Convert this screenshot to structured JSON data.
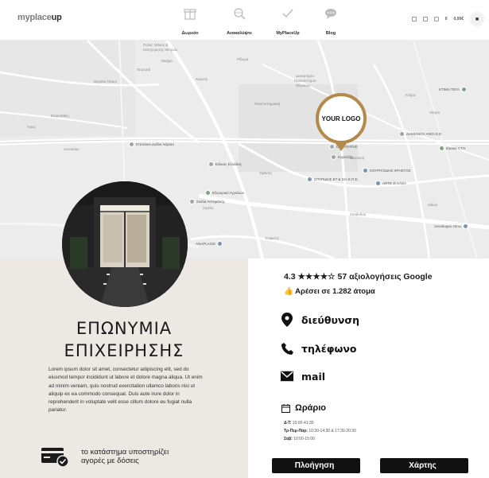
{
  "header": {
    "logo_main": "myplace",
    "logo_accent": "up",
    "nav": [
      {
        "label": "Δωρεάν",
        "icon": "gift-icon"
      },
      {
        "label": "Ανακαλύψτε",
        "icon": "search-globe-icon"
      },
      {
        "label": "MyPlaceUp",
        "icon": "checkmark-icon"
      },
      {
        "label": "Blog",
        "icon": "chat-bubble-icon"
      }
    ],
    "cart_amount": "0,00€",
    "cart_count": "0"
  },
  "map": {
    "pin_label": "YOUR LOGO",
    "labels": [
      "Πολύς Μάκας &",
      "Κατηγορητής Μετρών",
      "Μνήμα",
      "Πετρωτά",
      "Χαρνόλ",
      "Μεγάλο Πεύκο",
      "Ρίζωμα",
      "Διοικητήριο",
      "Πανεπιστήμιο",
      "Πειραιώς",
      "Πανεπιστημιακή",
      "Άγιος",
      "Ευρωπαϊκή",
      "Σιγάλα",
      "Κτήμα",
      "Αθηνά",
      "Καρπερή",
      "Ιαθών",
      "Λενουαίοι",
      "Σαλβαδόρ",
      "Κηφισός",
      "Υφάντες"
    ],
    "pois": [
      "Επιτελικό Διόδιο Λάρισα",
      "Ειδικός Ελλάδας",
      "Εξωτερικό Αγγελιών",
      "Σκάλα Αστυφάνης",
      "ΣΠΥΡΙΔΗΣ ΕΤ & ΣΙΑ Ε.Π.Ε.",
      "ΚΟΥΡΙΤΖΙΔΗΣ ΧΡΗΣΤΟΣ",
      "ARTE di CASA",
      "Καρατζής",
      "ANAPLASIS",
      "ΔΑΜΙΑΝΟΥ ΑΦΟΙ Ε.Ε.",
      "Ελαϊκα CTH",
      "Ξενοδοχείο Olmo",
      "KTIMA TEFA",
      "Ο ΜΑΧΗΤΗΣ"
    ]
  },
  "business": {
    "name_line1": "ΕΠΩΝΥΜΙΑ",
    "name_line2": "ΕΠΙΧΕΙΡΗΣΗΣ",
    "description": "Lorem ipsum dolor sit amet, consectetur adipiscing elit, sed do eiusmod tempor incididunt ut labore et dolore magna aliqua. Ut enim ad minim veniam, quis nostrud exercitation ullamco laboris nisi ut aliquip ex ea commodo consequat. Duis aute irure dolor in reprehenderit in voluptate velit esse cillum dolore eu fugiat nulla pariatur.",
    "installments_line1": "το κατάστημα υποστηρίζει",
    "installments_line2": "αγορές με δόσεις"
  },
  "info": {
    "rating_text": "4.3 ★★★★☆ 57 αξιολογήσεις Google",
    "likes_text": "Αρέσει σε 1.282 άτομα",
    "address_label": "διεύθυνση",
    "phone_label": "τηλέφωνο",
    "mail_label": "mail",
    "hours_title": "Ωράριο",
    "hours": [
      {
        "days": "Δ-Τ:",
        "time": "10:00-41:30"
      },
      {
        "days": "Τρ-Πεμ-Παρ:",
        "time": "10:30-14:30 & 17:30-20:30"
      },
      {
        "days": "Σαβ:",
        "time": "10:00-15:00"
      }
    ],
    "navigate_label": "Πλοήγηση",
    "map_label": "Χάρτης"
  },
  "colors": {
    "accent": "#b48a4a",
    "dark": "#111111",
    "panel": "#ece8e3"
  }
}
